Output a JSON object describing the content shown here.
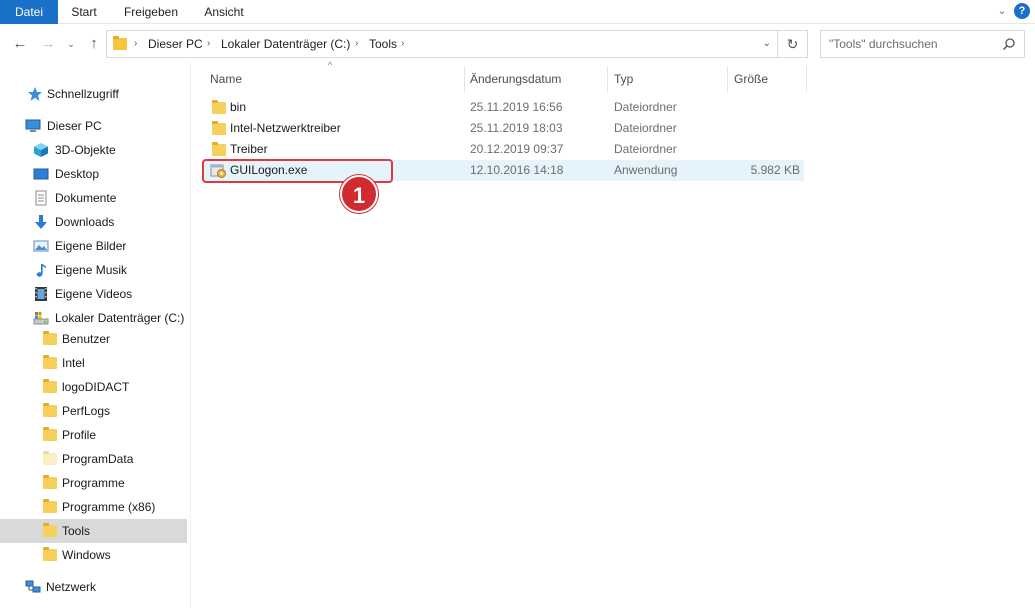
{
  "ribbon": {
    "tabs": [
      "Datei",
      "Start",
      "Freigeben",
      "Ansicht"
    ],
    "collapse_icon": "chevron-down-icon",
    "help_label": "?"
  },
  "address": {
    "crumbs": [
      "Dieser PC",
      "Lokaler Datenträger (C:)",
      "Tools"
    ],
    "search_placeholder": "\"Tools\" durchsuchen"
  },
  "sidebar": {
    "quick_access": "Schnellzugriff",
    "this_pc": "Dieser PC",
    "this_pc_items": [
      "3D-Objekte",
      "Desktop",
      "Dokumente",
      "Downloads",
      "Eigene Bilder",
      "Eigene Musik",
      "Eigene Videos",
      "Lokaler Datenträger (C:)"
    ],
    "drive_folders": [
      "Benutzer",
      "Intel",
      "logoDIDACT",
      "PerfLogs",
      "Profile",
      "ProgramData",
      "Programme",
      "Programme (x86)",
      "Tools",
      "Windows"
    ],
    "selected_folder": "Tools",
    "network": "Netzwerk"
  },
  "columns": {
    "name": "Name",
    "date": "Änderungsdatum",
    "type": "Typ",
    "size": "Größe"
  },
  "files": [
    {
      "name": "bin",
      "date": "25.11.2019 16:56",
      "type": "Dateiordner",
      "size": "",
      "icon": "folder-icon"
    },
    {
      "name": "Intel-Netzwerktreiber",
      "date": "25.11.2019 18:03",
      "type": "Dateiordner",
      "size": "",
      "icon": "folder-icon"
    },
    {
      "name": "Treiber",
      "date": "20.12.2019 09:37",
      "type": "Dateiordner",
      "size": "",
      "icon": "folder-icon"
    },
    {
      "name": "GUILogon.exe",
      "date": "12.10.2016 14:18",
      "type": "Anwendung",
      "size": "5.982 KB",
      "icon": "application-icon"
    }
  ],
  "annotation": {
    "step_number": "1",
    "highlight_color": "#e0393e"
  },
  "colors": {
    "accent": "#1a6fc6",
    "selection": "#e5f3fb",
    "sidebar_selected": "#d9d9d9",
    "folder": "#f6cf5c"
  }
}
